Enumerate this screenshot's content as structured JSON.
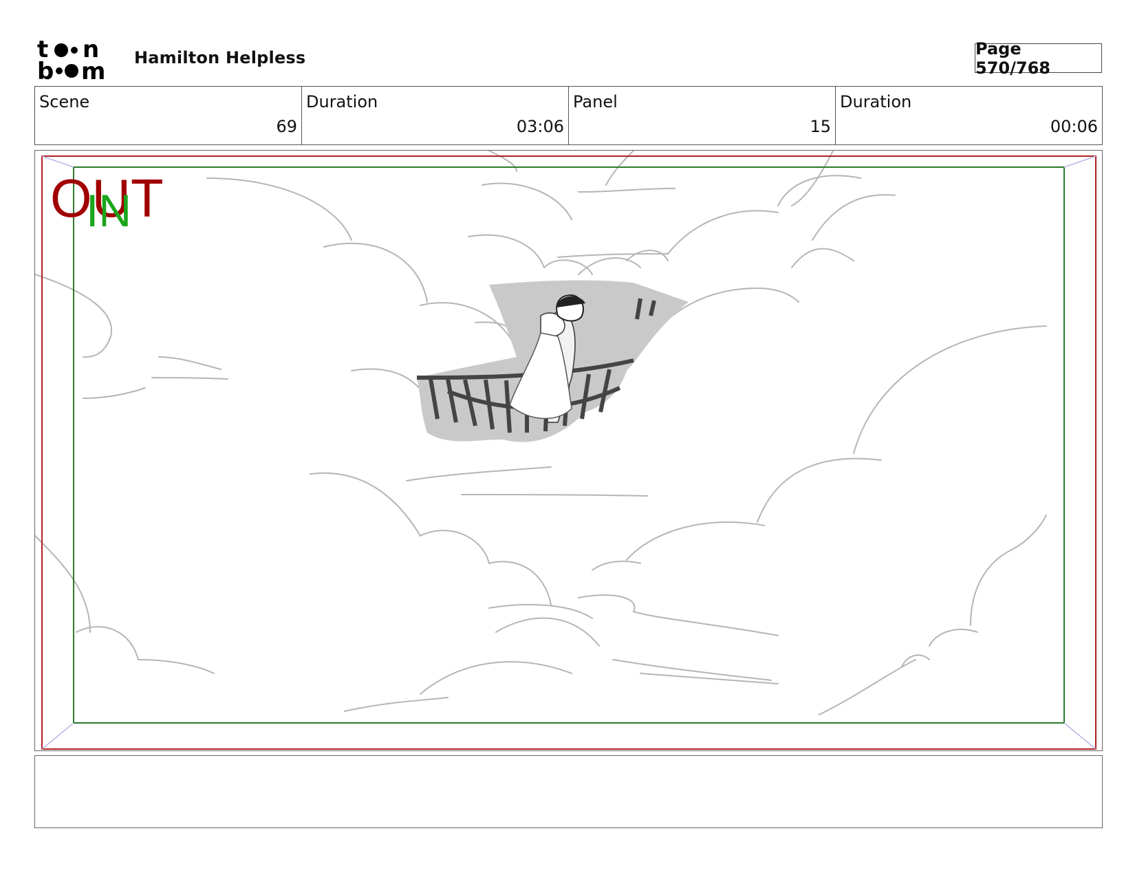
{
  "header": {
    "logo_icon": "toonboom-logo",
    "logo_text": "toon boom",
    "project_title": "Hamilton Helpless",
    "page_label": "Page 570/768"
  },
  "info": {
    "scene_label": "Scene",
    "scene_value": "69",
    "scene_duration_label": "Duration",
    "scene_duration_value": "03:06",
    "panel_label": "Panel",
    "panel_value": "15",
    "panel_duration_label": "Duration",
    "panel_duration_value": "00:06"
  },
  "panel": {
    "out_label": "OUT",
    "in_label": "IN",
    "out_color": "#a00000",
    "in_color": "#1aa51a",
    "safe_frame_color": "#2a7a2a",
    "camera_frame_color": "#b02020",
    "sketch_description_icon": "storyboard-sketch"
  },
  "notes": {
    "text": ""
  }
}
